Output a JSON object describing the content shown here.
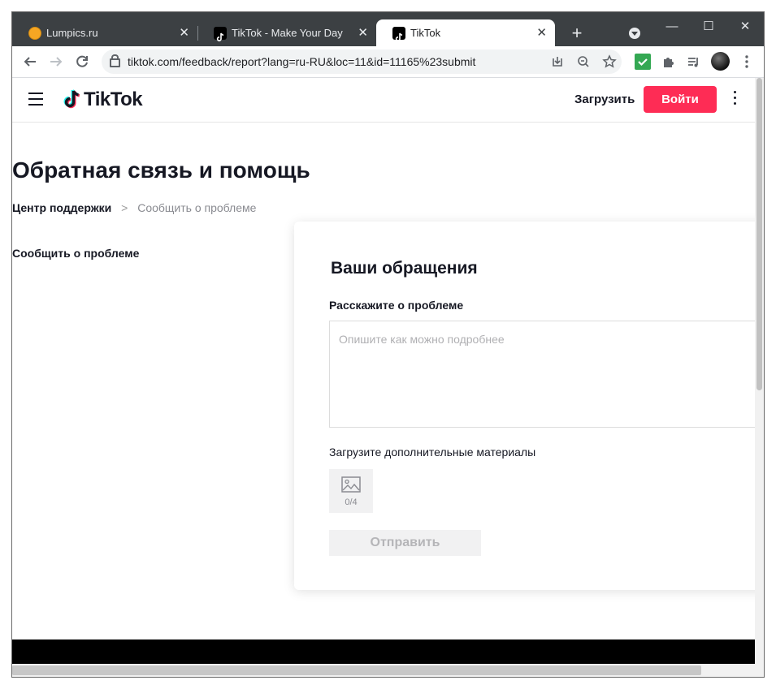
{
  "browser": {
    "tabs": [
      {
        "title": "Lumpics.ru",
        "fav_color": "#f6a623"
      },
      {
        "title": "TikTok - Make Your Day"
      },
      {
        "title": "TikTok"
      }
    ],
    "url": "tiktok.com/feedback/report?lang=ru-RU&loc=11&id=11165%23submit"
  },
  "header": {
    "logo_text": "TikTok",
    "upload_label": "Загрузить",
    "login_label": "Войти"
  },
  "page": {
    "title": "Обратная связь и помощь",
    "breadcrumb": {
      "home": "Центр поддержки",
      "separator": ">",
      "current": "Сообщить о проблеме"
    },
    "sidebar_item": "Сообщить о проблеме"
  },
  "form": {
    "title": "Ваши обращения",
    "problem_label": "Расскажите о проблеме",
    "problem_placeholder": "Опишите как можно подробнее",
    "attachments_label": "Загрузите дополнительные материалы",
    "attachments_count": "0/4",
    "submit_label": "Отправить"
  },
  "colors": {
    "accent": "#fe2c55",
    "tabbar": "#3c4043"
  }
}
